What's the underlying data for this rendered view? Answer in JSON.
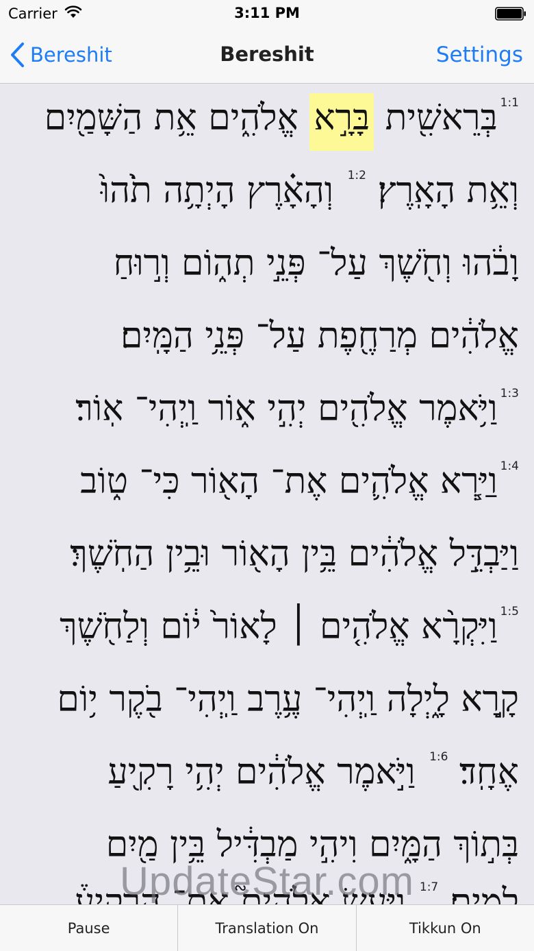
{
  "status_bar": {
    "carrier": "Carrier",
    "time": "3:11 PM"
  },
  "nav": {
    "back_label": "Bereshit",
    "title": "Bereshit",
    "settings_label": "Settings"
  },
  "text": {
    "lines": [
      {
        "verse": "1:1",
        "pre": "בְּרֵאשִׁ֖ית ",
        "highlight": "בָּרָ֣א",
        "post": " אֱלֹהִ֑ים אֵ֥ת הַשָּׁמַ֖יִם"
      },
      {
        "pre": "וְאֵ֥ת הָאָֽרֶץ׃ ",
        "verse": "1:2",
        "post": " וְהָאָ֗רֶץ הָיְתָ֥ה תֹ֙הוּ֙"
      },
      {
        "pre": "וָבֹ֔הוּ וְחֹ֖שֶׁךְ עַל־ פְּנֵ֣י תְה֑וֹם וְר֣וּחַ"
      },
      {
        "pre": "אֱלֹהִ֔ים מְרַחֶ֖פֶת עַל־ פְּנֵ֥י הַמָּֽיִם׃"
      },
      {
        "verse": "1:3",
        "pre": "וַיֹּ֥אמֶר אֱלֹהִ֖ים יְהִ֣י א֑וֹר וַֽיְהִי־ אֽוֹר׃"
      },
      {
        "verse": "1:4",
        "pre": "וַיַּ֧רְא אֱלֹהִ֛ים אֶת־ הָא֖וֹר כִּי־ ט֑וֹב"
      },
      {
        "pre": "וַיַּבְדֵּ֣ל אֱלֹהִ֔ים בֵּ֥ין הָא֖וֹר וּבֵ֥ין הַחֹֽשֶׁךְ׃"
      },
      {
        "verse": "1:5",
        "pre": "וַיִּקְרָ֨א אֱלֹהִ֤ים ׀ לָאוֹר֙ י֔וֹם וְלַחֹ֖שֶׁךְ"
      },
      {
        "pre": "קָ֣רָא לָ֑יְלָה וַֽיְהִי־ עֶ֥רֶב וַֽיְהִי־ בֹ֖קֶר י֥וֹם"
      },
      {
        "pre": "אֶחָֽד׃ ",
        "verse": "1:6",
        "post": " וַיֹּ֣אמֶר אֱלֹהִ֔ים יְהִ֥י רָקִ֖יעַ"
      },
      {
        "pre": "בְּת֣וֹךְ הַמָּ֑יִם וִיהִ֣י מַבְדִּ֔יל בֵּ֥ין מַ֖יִם"
      },
      {
        "pre": "לָמָֽיִם׃ ",
        "verse": "1:7",
        "post": " וַיַּ֣עַשׂ אֱלֹהִים֮ אֶת־ הָרָקִיעַ֒"
      }
    ]
  },
  "watermark": "UpdateStar.com",
  "toolbar": {
    "pause_label": "Pause",
    "translation_label": "Translation On",
    "tikkun_label": "Tikkun On"
  }
}
